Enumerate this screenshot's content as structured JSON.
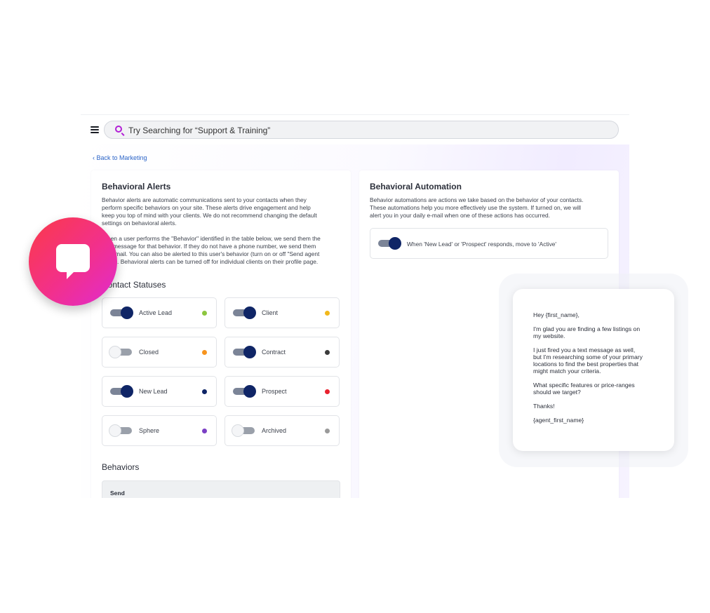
{
  "search": {
    "placeholder": "Try Searching for “Support & Training”"
  },
  "nav": {
    "back_label": "Back to Marketing",
    "back_chevron": "‹"
  },
  "alerts": {
    "title": "Behavioral Alerts",
    "desc1": [
      "Behavior alerts are automatic communications sent to your contacts when they",
      "perform specific behaviors on your site. These alerts drive engagement and help",
      "keep you top of mind with your clients. We do not recommend changing the default",
      "settings on behavioral alerts."
    ],
    "desc2": [
      "When a user performs the \"Behavior\" identified in the table below, we send them the",
      "text message for that behavior. If they do not have a phone number, we send them",
      "an e-mail. You can also be alerted to this user's behavior (turn on or off \"Send agent",
      "alert\"). Behavioral alerts can be turned off for individual clients on their profile page."
    ]
  },
  "contact_statuses": {
    "title": "Contact Statuses",
    "items": [
      {
        "label": "Active Lead",
        "on": true,
        "color": "#8cc63f"
      },
      {
        "label": "Client",
        "on": true,
        "color": "#f1b81b"
      },
      {
        "label": "Closed",
        "on": false,
        "color": "#f7941d"
      },
      {
        "label": "Contract",
        "on": true,
        "color": "#3b3b3b"
      },
      {
        "label": "New Lead",
        "on": true,
        "color": "#0f2566"
      },
      {
        "label": "Prospect",
        "on": true,
        "color": "#e8212e"
      },
      {
        "label": "Sphere",
        "on": false,
        "color": "#7b3fc4"
      },
      {
        "label": "Archived",
        "on": false,
        "color": "#9a9a9a"
      }
    ]
  },
  "behaviors": {
    "title": "Behaviors",
    "send_label": "Send"
  },
  "automation": {
    "title": "Behavioral Automation",
    "desc": [
      "Behavior automations are actions we take based on the behavior of your contacts.",
      "These automations help you more effectively use the system. If turned on, we will",
      "alert you in your daily e-mail when one of these actions has occurred."
    ],
    "rule_label": "When 'New Lead' or 'Prospect' responds, move to 'Active'",
    "rule_on": true
  },
  "message": {
    "greeting": "Hey {first_name},",
    "p1": "I'm glad you are finding a few listings on\nmy website.",
    "p2": "I just fired you a text message as well,\nbut I'm researching some of your primary\nlocations to find the best properties that\nmight match your criteria.",
    "p3": "What specific features or price-ranges\nshould we target?",
    "p4": "Thanks!",
    "signature": "{agent_first_name}"
  },
  "colors": {
    "accent": "#b21fd6",
    "toggle_on": "#0f2566",
    "link": "#2a63c7",
    "badge_start": "#fb3a48",
    "badge_end": "#e02bd0"
  },
  "icons": {
    "menu": "hamburger-menu-icon",
    "search": "search-icon",
    "back": "chevron-left-icon",
    "chat": "chat-bubble-icon"
  }
}
